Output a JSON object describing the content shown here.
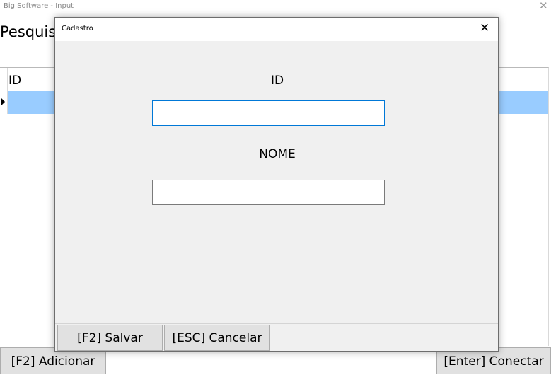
{
  "main_window": {
    "title": "Big Software - Input",
    "close_glyph": "✕",
    "search_label": "Pesquis",
    "grid": {
      "columns": [
        "ID"
      ],
      "rows": [
        {
          "selected": true,
          "id": ""
        }
      ]
    },
    "add_button": "[F2] Adicionar",
    "connect_button": "[Enter] Conectar"
  },
  "dialog": {
    "title": "Cadastro",
    "close_glyph": "✕",
    "id_label": "ID",
    "id_value": "",
    "nome_label": "NOME",
    "nome_value": "",
    "save_button": "[F2] Salvar",
    "cancel_button": "[ESC] Cancelar"
  },
  "colors": {
    "selection": "#99ccff",
    "focus_border": "#0078d7",
    "dialog_background": "#f0f0f0"
  }
}
